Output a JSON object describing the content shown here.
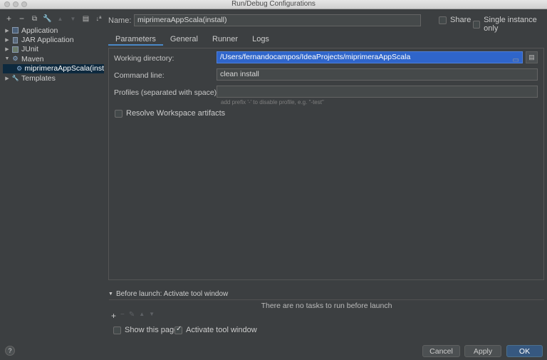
{
  "window": {
    "title": "Run/Debug Configurations"
  },
  "toolbar": {
    "icons": [
      "add-icon",
      "remove-icon",
      "copy-icon",
      "wrench-icon",
      "move-up-icon",
      "move-down-icon",
      "folder-icon",
      "sort-icon"
    ]
  },
  "tree": {
    "items": [
      {
        "label": "Application",
        "icon": "application-icon",
        "expanded": false
      },
      {
        "label": "JAR Application",
        "icon": "jar-icon",
        "expanded": false
      },
      {
        "label": "JUnit",
        "icon": "junit-icon",
        "expanded": false
      },
      {
        "label": "Maven",
        "icon": "maven-icon",
        "expanded": true
      },
      {
        "label": "miprimeraAppScala(inst",
        "icon": "maven-config-icon",
        "selected": true
      },
      {
        "label": "Templates",
        "icon": "wrench-icon",
        "expanded": false
      }
    ]
  },
  "header": {
    "name_label": "Name:",
    "name_value": "miprimeraAppScala(install)",
    "share_label": "Share",
    "single_instance_label": "Single instance only"
  },
  "tabs": [
    {
      "label": "Parameters",
      "active": true
    },
    {
      "label": "General"
    },
    {
      "label": "Runner"
    },
    {
      "label": "Logs"
    }
  ],
  "parameters": {
    "working_dir_label": "Working directory:",
    "working_dir_value": "/Users/fernandocampos/IdeaProjects/miprimeraAppScala",
    "command_line_label": "Command line:",
    "command_line_value": "clean install",
    "profiles_label": "Profiles (separated with space):",
    "profiles_value": "",
    "profiles_hint": "add prefix '-' to disable profile, e.g. \"-test\"",
    "resolve_label": "Resolve Workspace artifacts"
  },
  "before_launch": {
    "title": "Before launch: Activate tool window",
    "empty_message": "There are no tasks to run before launch",
    "show_page_label": "Show this page",
    "activate_label": "Activate tool window"
  },
  "buttons": {
    "help": "?",
    "cancel": "Cancel",
    "apply": "Apply",
    "ok": "OK"
  },
  "colors": {
    "background": "#3c3f41",
    "selection": "#0d293e",
    "primary_button": "#365880",
    "tab_underline": "#4a88c7"
  }
}
